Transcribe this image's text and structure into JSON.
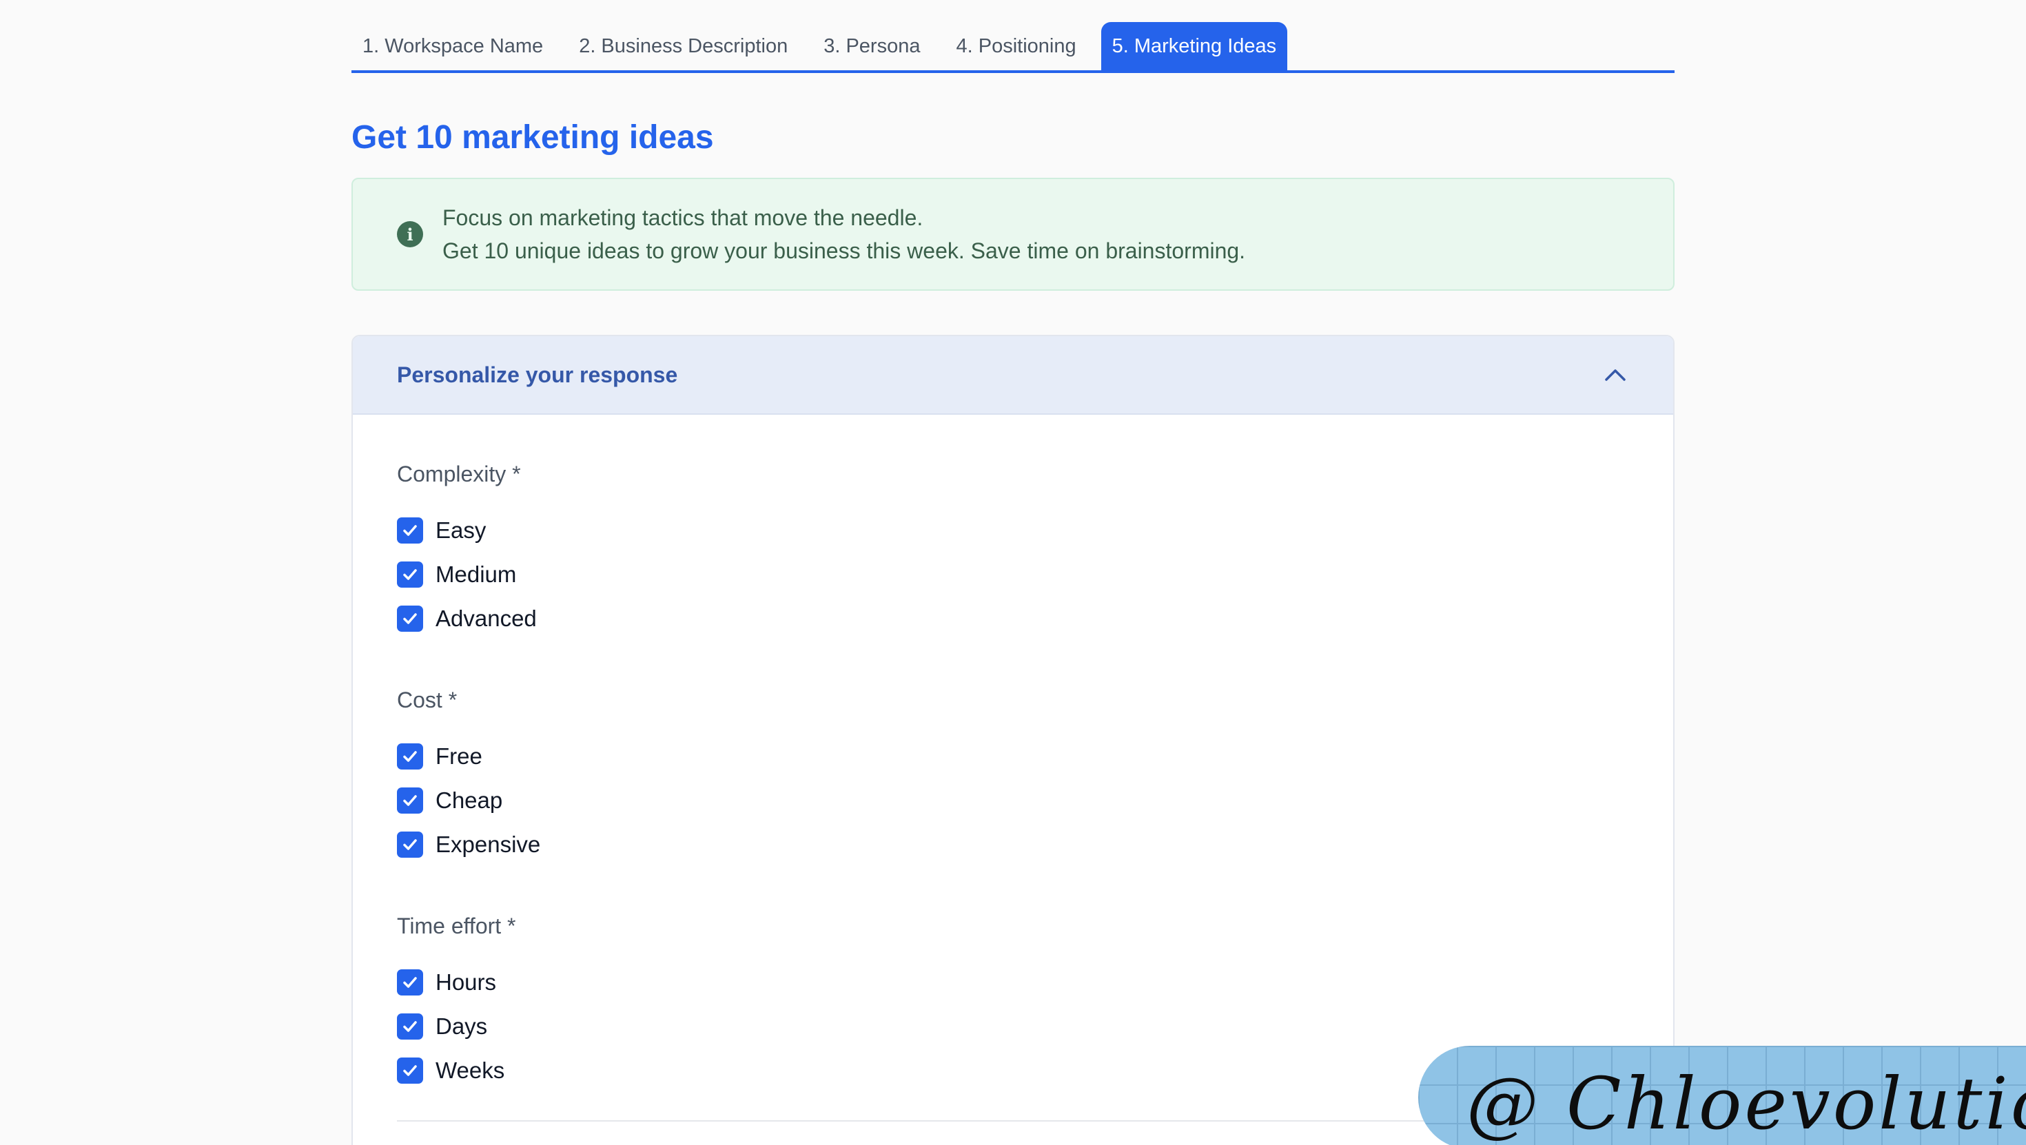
{
  "tabs": [
    {
      "label": "1. Workspace Name"
    },
    {
      "label": "2. Business Description"
    },
    {
      "label": "3. Persona"
    },
    {
      "label": "4. Positioning"
    },
    {
      "label": "5. Marketing Ideas",
      "active": true
    }
  ],
  "page": {
    "title": "Get 10 marketing ideas"
  },
  "info": {
    "icon": "info-icon",
    "line1": "Focus on marketing tactics that move the needle.",
    "line2": "Get 10 unique ideas to grow your business this week. Save time on brainstorming."
  },
  "personalize": {
    "title": "Personalize your response",
    "expanded": true,
    "groups": [
      {
        "label": "Complexity *",
        "options": [
          {
            "label": "Easy",
            "checked": true
          },
          {
            "label": "Medium",
            "checked": true
          },
          {
            "label": "Advanced",
            "checked": true
          }
        ]
      },
      {
        "label": "Cost *",
        "options": [
          {
            "label": "Free",
            "checked": true
          },
          {
            "label": "Cheap",
            "checked": true
          },
          {
            "label": "Expensive",
            "checked": true
          }
        ]
      },
      {
        "label": "Time effort *",
        "options": [
          {
            "label": "Hours",
            "checked": true
          },
          {
            "label": "Days",
            "checked": true
          },
          {
            "label": "Weeks",
            "checked": true
          }
        ]
      }
    ]
  },
  "watermark": {
    "text": "@ Chloevolution"
  },
  "colors": {
    "accent": "#2563eb",
    "info_bg": "#eaf8ef",
    "header_bg": "#e6ecf8"
  }
}
